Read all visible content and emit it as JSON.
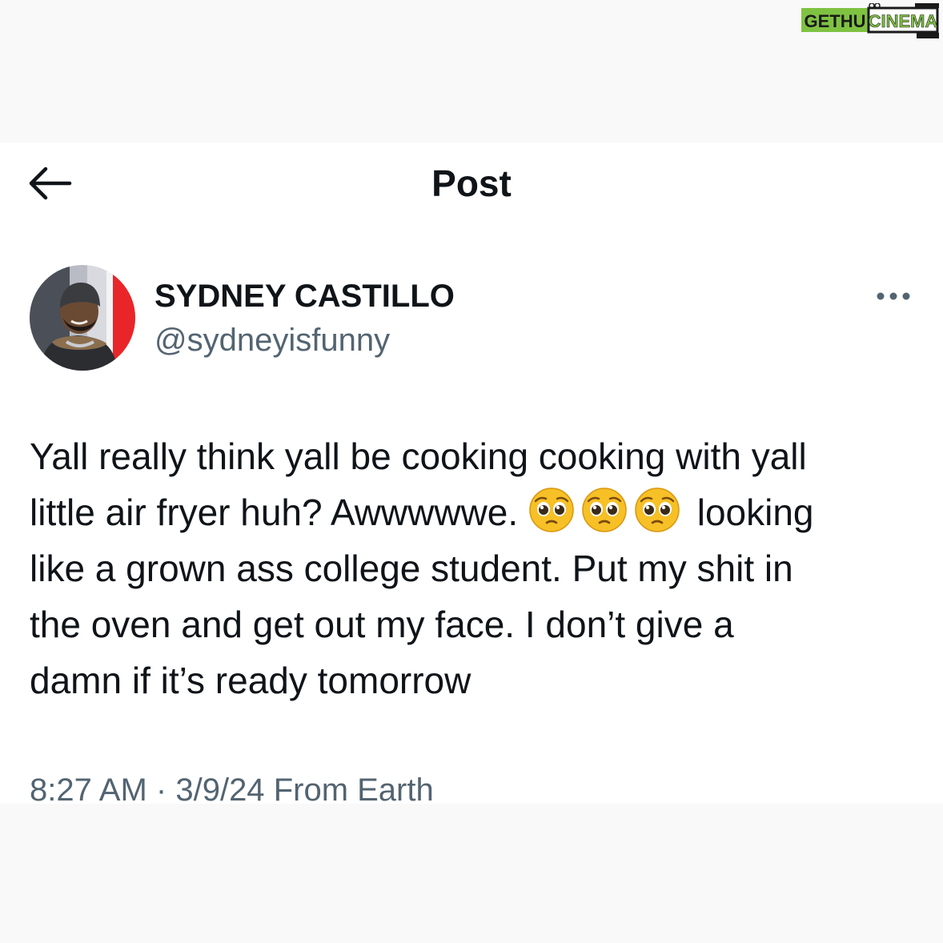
{
  "watermark": {
    "left": "GETHU",
    "right": "CINEMA"
  },
  "header": {
    "title": "Post",
    "back_icon": "arrow-left-icon"
  },
  "author": {
    "display_name": "SYDNEY CASTILLO",
    "handle": "@sydneyisfunny",
    "avatar": "profile-photo"
  },
  "tweet": {
    "line1": "Yall really think yall be cooking cooking with yall",
    "line2_start": "little air fryer huh? Awwwwwe.",
    "emojis": [
      "pleading-face-icon",
      "pleading-face-icon",
      "pleading-face-icon"
    ],
    "line2_end": "looking",
    "line3": "like a grown ass college student. Put my shit in",
    "line4": "the oven and get out my face. I don’t give a",
    "line5": "damn if it’s ready tomorrow"
  },
  "meta": {
    "time": "8:27 AM",
    "separator": "·",
    "date": "3/9/24",
    "source": "From Earth"
  },
  "colors": {
    "text": "#0f1419",
    "secondary": "#536471",
    "page_bg": "#f9f9f9",
    "card_bg": "#ffffff",
    "watermark_green": "#7fc242"
  }
}
